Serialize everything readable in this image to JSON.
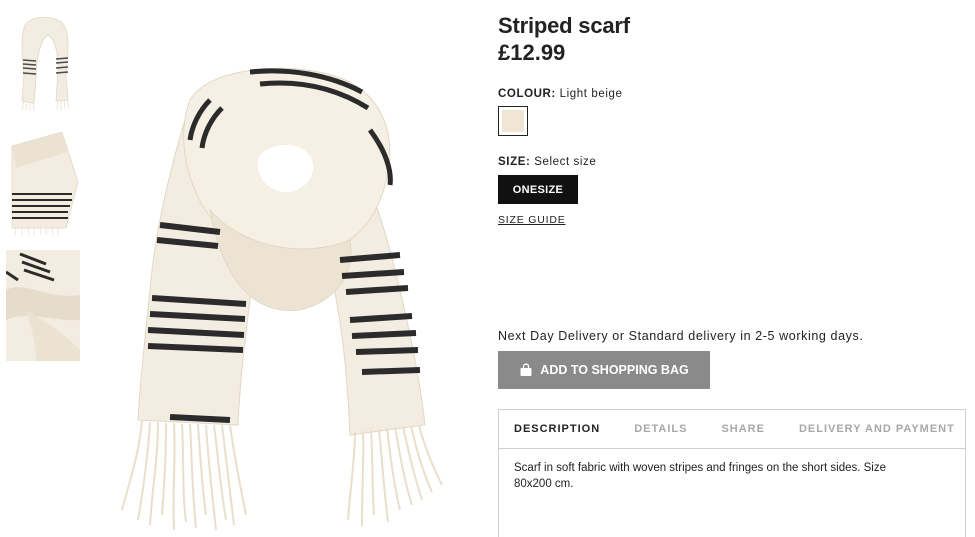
{
  "product": {
    "title": "Striped scarf",
    "price": "£12.99"
  },
  "colour": {
    "label": "COLOUR:",
    "selected": "Light beige",
    "swatch_color": "#efe6d6"
  },
  "size": {
    "label": "SIZE:",
    "selected": "Select size",
    "options": [
      "ONESIZE"
    ],
    "guide_label": "SIZE GUIDE"
  },
  "delivery_note": "Next Day Delivery or Standard delivery in 2-5 working days.",
  "add_to_bag": {
    "label": "ADD TO SHOPPING BAG",
    "icon": "shopping-bag-icon",
    "bg_color": "#8a8a8a"
  },
  "tabs": [
    {
      "label": "DESCRIPTION",
      "active": true
    },
    {
      "label": "DETAILS",
      "active": false
    },
    {
      "label": "SHARE",
      "active": false
    },
    {
      "label": "DELIVERY AND PAYMENT",
      "active": false
    }
  ],
  "description": "Scarf in soft fabric with woven stripes and fringes on the short sides. Size 80x200 cm.",
  "colors": {
    "scarf_cream": "#f3ece0",
    "scarf_shadow": "#e2d7c4",
    "stripe_dark": "#2b2b2b",
    "text": "#222222",
    "muted_tab": "#a8a8a8"
  }
}
